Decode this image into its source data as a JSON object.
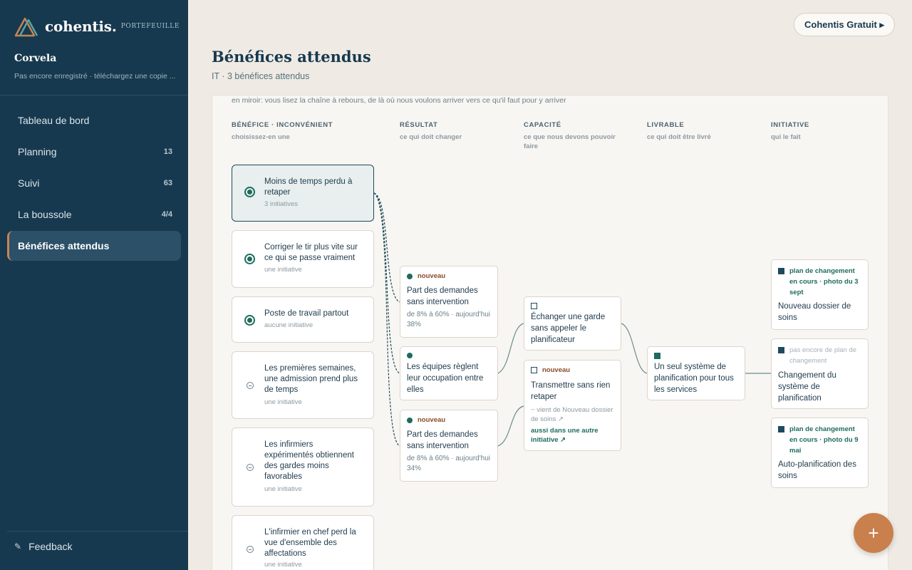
{
  "sidebar": {
    "logo_text": "cohentis.",
    "portfolio_tag": "PORTEFEUILLE",
    "org_name": "Corvela",
    "org_sub": "Pas encore enregistré · téléchargez une copie ...",
    "items": [
      {
        "label": "Tableau de bord",
        "count": ""
      },
      {
        "label": "Planning",
        "count": "13"
      },
      {
        "label": "Suivi",
        "count": "63"
      },
      {
        "label": "La boussole",
        "count": "4/4"
      },
      {
        "label": "Bénéfices attendus",
        "count": ""
      }
    ],
    "feedback_icon": "✎",
    "feedback_label": "Feedback"
  },
  "header": {
    "plan_button": "Cohentis Gratuit ▸",
    "title": "Bénéfices attendus",
    "subtitle": "IT · 3 bénéfices attendus"
  },
  "panel": {
    "intro": "en miroir: vous lisez la chaîne à rebours, de là où nous voulons arriver vers ce qu'il faut pour y arriver",
    "columns": [
      {
        "head": "BÉNÉFICE · INCONVÉNIENT",
        "sub": "choisissez-en une"
      },
      {
        "head": "RÉSULTAT",
        "sub": "ce qui doit changer"
      },
      {
        "head": "CAPACITÉ",
        "sub": "ce que nous devons pouvoir faire"
      },
      {
        "head": "LIVRABLE",
        "sub": "ce qui doit être livré"
      },
      {
        "head": "INITIATIVE",
        "sub": "qui le fait"
      }
    ]
  },
  "benefits": [
    {
      "title": "Moins de temps perdu à retaper",
      "meta": "3 initiatives"
    },
    {
      "title": "Corriger le tir plus vite sur ce qui se passe vraiment",
      "meta": "une initiative"
    },
    {
      "title": "Poste de travail partout",
      "meta": "aucune initiative"
    },
    {
      "title": "Les premières semaines, une admission prend plus de temps",
      "meta": "une initiative"
    },
    {
      "title": "Les infirmiers expérimentés obtiennent des gardes moins favorables",
      "meta": "une initiative"
    },
    {
      "title": "L'infirmier en chef perd la vue d'ensemble des affectations",
      "meta": "une initiative"
    }
  ],
  "results": [
    {
      "tag": "nouveau",
      "title": "Part des demandes sans intervention",
      "meta": "de 8% à 60% · aujourd'hui 38%"
    },
    {
      "tag": "",
      "title": "Les équipes règlent leur occupation entre elles",
      "meta": ""
    },
    {
      "tag": "nouveau",
      "title": "Part des demandes sans intervention",
      "meta": "de 8% à 60% · aujourd'hui 34%"
    }
  ],
  "capabilities": [
    {
      "tag": "",
      "title": "Échanger une garde sans appeler le planificateur"
    },
    {
      "tag": "nouveau",
      "title": "Transmettre sans rien retaper",
      "from": "┄ vient de Nouveau dossier de soins ↗",
      "link": "aussi dans une autre initiative ↗"
    }
  ],
  "deliverable": {
    "title": "Un seul système de planification pour tous les services"
  },
  "initiatives": [
    {
      "status": "plan de changement en cours · photo du 3 sept",
      "title": "Nouveau dossier de soins"
    },
    {
      "status": "pas encore de plan de changement",
      "title": "Changement du système de planification"
    },
    {
      "status": "plan de changement en cours · photo du 9 mai",
      "title": "Auto-planification des soins"
    }
  ],
  "fab_label": "+"
}
